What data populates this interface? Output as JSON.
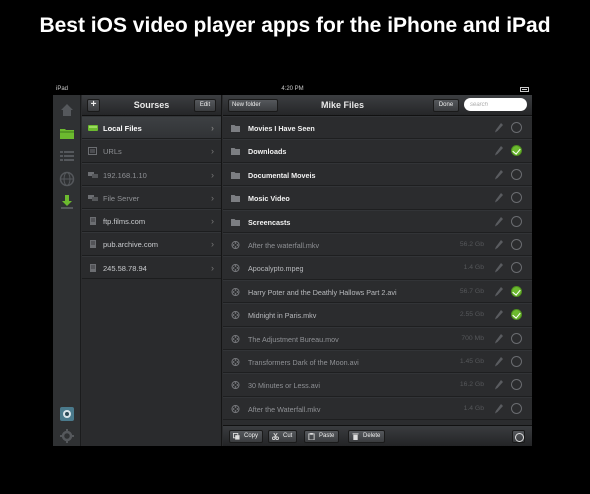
{
  "headline": "Best iOS video player apps for the iPhone and iPad",
  "status_bar": {
    "device": "iPad",
    "time": "4:20 PM"
  },
  "rail": {
    "icons": [
      "home-icon",
      "folder-icon",
      "list-icon",
      "globe-icon",
      "download-icon",
      "app-logo-icon",
      "settings-icon"
    ],
    "selected": "folder-icon"
  },
  "sources": {
    "title": "Sourses",
    "add_label": "+",
    "edit_label": "Edit",
    "items": [
      {
        "label": "Local Files",
        "icon": "drive-icon"
      },
      {
        "label": "URLs",
        "icon": "link-icon"
      },
      {
        "label": "192.168.1.10",
        "icon": "network-icon"
      },
      {
        "label": "File Server",
        "icon": "network-icon"
      },
      {
        "label": "ftp.films.com",
        "icon": "ftp-icon"
      },
      {
        "label": "pub.archive.com",
        "icon": "ftp-icon"
      },
      {
        "label": "245.58.78.94",
        "icon": "ftp-icon"
      }
    ]
  },
  "files": {
    "title": "Mike Files",
    "new_folder_label": "New folder",
    "done_label": "Done",
    "search_placeholder": "search",
    "rows": [
      {
        "name": "Movies I Have Seen",
        "type": "folder",
        "size": "",
        "checked": false
      },
      {
        "name": "Downloads",
        "type": "folder",
        "size": "",
        "checked": true
      },
      {
        "name": "Documental Moveis",
        "type": "folder",
        "size": "",
        "checked": false
      },
      {
        "name": "Mosic Video",
        "type": "folder",
        "size": "",
        "checked": false
      },
      {
        "name": "Screencasts",
        "type": "folder",
        "size": "",
        "checked": false
      },
      {
        "name": "After the waterfall.mkv",
        "type": "video",
        "size": "56.2 Gb",
        "checked": false
      },
      {
        "name": "Apocalypto.mpeg",
        "type": "video",
        "size": "1.4 Gb",
        "checked": false
      },
      {
        "name": "Harry Poter and the Deathly Hallows Part 2.avi",
        "type": "video",
        "size": "56.7 Gb",
        "checked": true
      },
      {
        "name": "Midnight in Paris.mkv",
        "type": "video",
        "size": "2.55 Gb",
        "checked": true
      },
      {
        "name": "The Adjustment Bureau.mov",
        "type": "video",
        "size": "700 Mb",
        "checked": false
      },
      {
        "name": "Transformers Dark of the Moon.avi",
        "type": "video",
        "size": "1.45 Gb",
        "checked": false
      },
      {
        "name": "30 Minutes or Less.avi",
        "type": "video",
        "size": "16.2 Gb",
        "checked": false
      },
      {
        "name": "After the Waterfall.mkv",
        "type": "video",
        "size": "1.4 Gb",
        "checked": false
      }
    ],
    "toolbar": {
      "copy": "Copy",
      "cut": "Cut",
      "paste": "Paste",
      "delete": "Delete"
    }
  },
  "colors": {
    "accent_green": "#6cba2f",
    "background": "#000000",
    "panel": "#2b2c2e"
  }
}
